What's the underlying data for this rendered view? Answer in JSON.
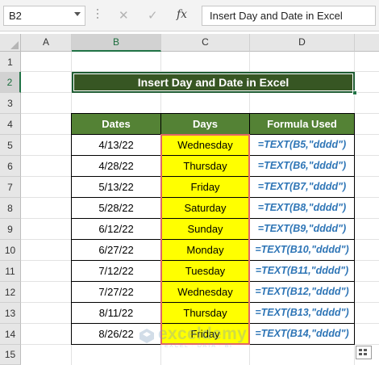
{
  "formula_bar": {
    "name_box": "B2",
    "cancel_icon": "✕",
    "enter_icon": "✓",
    "fx_label": "fx",
    "formula": "Insert Day and Date in Excel"
  },
  "columns": [
    "A",
    "B",
    "C",
    "D"
  ],
  "selected_column": "B",
  "rows": [
    "1",
    "2",
    "3",
    "4",
    "5",
    "6",
    "7",
    "8",
    "9",
    "10",
    "11",
    "12",
    "13",
    "14",
    "15"
  ],
  "selected_row": "2",
  "title": "Insert Day and Date in Excel",
  "table": {
    "headers": [
      "Dates",
      "Days",
      "Formula Used"
    ],
    "rows": [
      {
        "date": "4/13/22",
        "day": "Wednesday",
        "formula": "=TEXT(B5,\"dddd\")"
      },
      {
        "date": "4/28/22",
        "day": "Thursday",
        "formula": "=TEXT(B6,\"dddd\")"
      },
      {
        "date": "5/13/22",
        "day": "Friday",
        "formula": "=TEXT(B7,\"dddd\")"
      },
      {
        "date": "5/28/22",
        "day": "Saturday",
        "formula": "=TEXT(B8,\"dddd\")"
      },
      {
        "date": "6/12/22",
        "day": "Sunday",
        "formula": "=TEXT(B9,\"dddd\")"
      },
      {
        "date": "6/27/22",
        "day": "Monday",
        "formula": "=TEXT(B10,\"dddd\")"
      },
      {
        "date": "7/12/22",
        "day": "Tuesday",
        "formula": "=TEXT(B11,\"dddd\")"
      },
      {
        "date": "7/27/22",
        "day": "Wednesday",
        "formula": "=TEXT(B12,\"dddd\")"
      },
      {
        "date": "8/11/22",
        "day": "Thursday",
        "formula": "=TEXT(B13,\"dddd\")"
      },
      {
        "date": "8/26/22",
        "day": "Friday",
        "formula": "=TEXT(B14,\"dddd\")"
      }
    ]
  },
  "watermark": {
    "name": "exceldemy",
    "tagline": "EXCEL · DATA · BI"
  },
  "colors": {
    "title_bg": "#375623",
    "header_bg": "#548235",
    "days_bg": "#ffff00",
    "formula_text": "#2e75b6",
    "days_border": "#e06666",
    "selection": "#217346"
  },
  "icons": {
    "quick_analysis": "quick-analysis-icon"
  }
}
